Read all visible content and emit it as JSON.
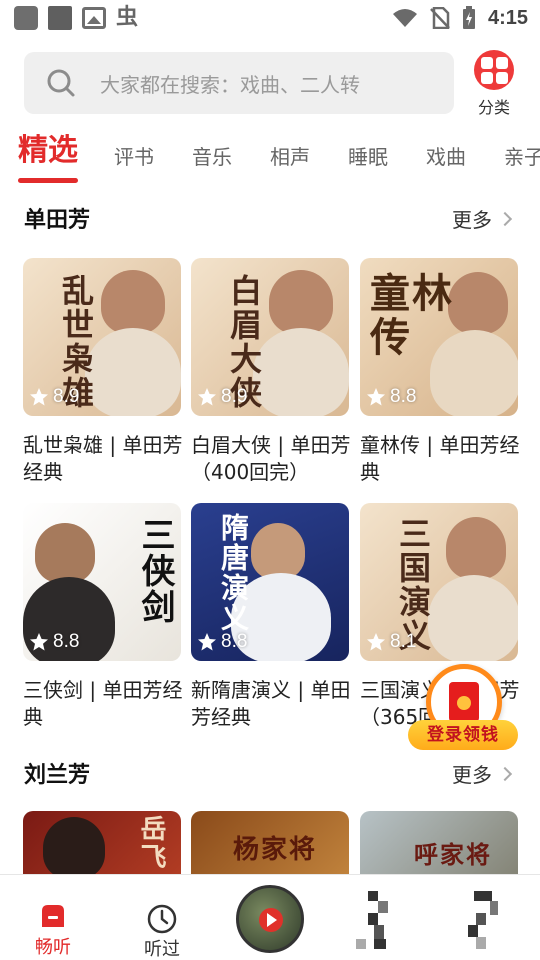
{
  "status_bar": {
    "time": "4:15",
    "glyph": "虫"
  },
  "search": {
    "placeholder": "大家都在搜索：戏曲、二人转"
  },
  "category_button": {
    "label": "分类"
  },
  "tabs": [
    {
      "label": "精选",
      "active": true
    },
    {
      "label": "评书"
    },
    {
      "label": "音乐"
    },
    {
      "label": "相声"
    },
    {
      "label": "睡眠"
    },
    {
      "label": "戏曲"
    },
    {
      "label": "亲子"
    }
  ],
  "sections": [
    {
      "title": "单田芳",
      "more": "更多",
      "cards": [
        {
          "title": "乱世枭雄 | 单田芳经典",
          "rating": "8.9",
          "cover_text": "乱世枭雄"
        },
        {
          "title": "白眉大侠 | 单田芳（400回完）",
          "rating": "8.9",
          "cover_text": "白眉大侠"
        },
        {
          "title": "童林传 | 单田芳经典",
          "rating": "8.8",
          "cover_text": "童林传"
        },
        {
          "title": "三侠剑 | 单田芳经典",
          "rating": "8.8",
          "cover_text": "三侠剑"
        },
        {
          "title": "新隋唐演义 | 单田芳经典",
          "rating": "8.8",
          "cover_text": "隋唐演义"
        },
        {
          "title": "三国演义 | 单田芳（365回）| 典",
          "rating": "8.1",
          "cover_text": "三国演义"
        }
      ]
    },
    {
      "title": "刘兰芳",
      "more": "更多",
      "cards": [
        {
          "cover_text": "岳飞"
        },
        {
          "cover_text": "杨家将"
        },
        {
          "cover_text": "呼家将"
        }
      ]
    }
  ],
  "red_packet": {
    "label": "登录领钱"
  },
  "bottom_nav": [
    {
      "label": "畅听",
      "active": true
    },
    {
      "label": "听过"
    }
  ],
  "colors": {
    "accent": "#e22b2b",
    "rating_text": "#ffffff",
    "packet_orange": "#ff8a1a"
  }
}
